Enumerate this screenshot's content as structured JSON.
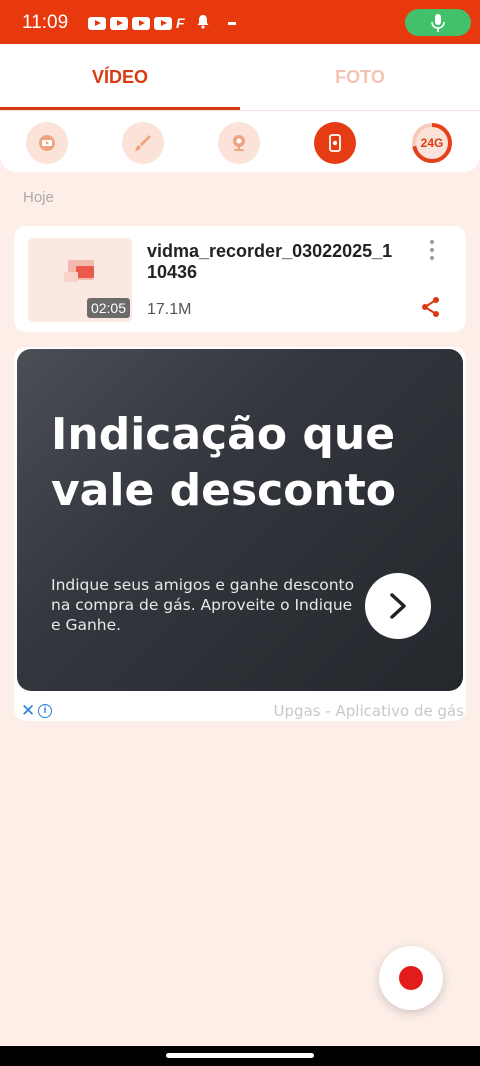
{
  "status_bar": {
    "time": "11:09",
    "notification_icons": [
      "youtube-icon",
      "youtube-icon",
      "youtube-icon",
      "youtube-icon",
      "f-icon",
      "bell-icon",
      "minus-icon"
    ],
    "mic_indicator_color": "#43c06a"
  },
  "tabs": [
    {
      "label": "VÍDEO",
      "active": true
    },
    {
      "label": "FOTO",
      "active": false
    }
  ],
  "toolbar": {
    "tools": [
      "video-play-icon",
      "brush-icon",
      "webcam-icon",
      "screen-record-icon"
    ],
    "storage_label": "24G",
    "storage_used_fraction": 0.72
  },
  "section": {
    "date_label": "Hoje"
  },
  "recording": {
    "name": "vidma_recorder_03022025_110436",
    "duration": "02:05",
    "size": "17.1M"
  },
  "ad": {
    "headline": "Indicação que vale desconto",
    "body": "Indique seus amigos e ganhe desconto na compra de gás. Aproveite o Indique e Ganhe.",
    "advertiser": "Upgas - Aplicativo de gás"
  },
  "colors": {
    "accent": "#e8390e",
    "tab_active": "#d93a13",
    "background": "#fdeee8",
    "record_dot": "#e41b1b"
  }
}
